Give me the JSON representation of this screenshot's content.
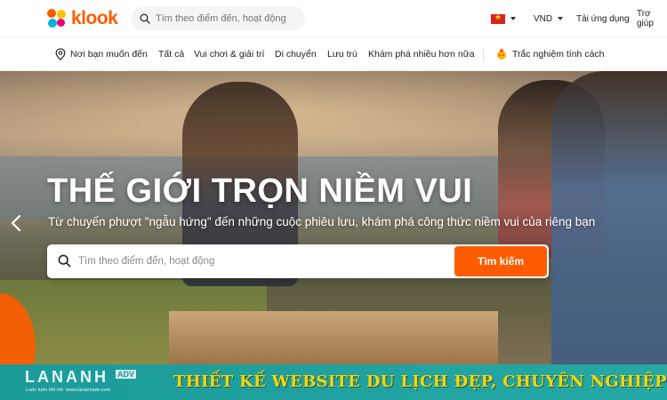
{
  "header": {
    "logo_text": "klook",
    "search_placeholder": "Tìm theo điểm đến, hoạt động",
    "currency": "VND",
    "app_download": "Tải ứng dụng",
    "help": "Trợ giúp",
    "language_icon": "vietnam-flag-icon"
  },
  "nav": {
    "location": "Nơi bạn muốn đến",
    "items": [
      "Tất cả",
      "Vui chơi & giải trí",
      "Di chuyển",
      "Lưu trú",
      "Khám phá nhiều hơn nữa"
    ],
    "quiz": "Trắc nghiệm tính cách"
  },
  "hero": {
    "title": "THẾ GIỚI TRỌN NIỀM VUI",
    "subtitle": "Từ chuyến phượt \"ngẫu hứng\" đến những cuộc phiêu lưu, khám phá công thức niềm vui của riêng bạn",
    "search_placeholder": "Tìm theo điểm đến, hoạt động",
    "search_button": "Tìm kiếm"
  },
  "banner": {
    "logo_main": "LANANH",
    "logo_sup": "ADV",
    "logo_tagline": "Luôn luôn kết nối",
    "logo_url": "www.lananhadv.com",
    "text": "THIẾT KẾ WEBSITE DU LỊCH ĐẸP, CHUYÊN NGHIỆP"
  },
  "colors": {
    "brand": "#ff5b00",
    "banner_bg": "#1b9a9a",
    "banner_text": "#ffd400"
  }
}
